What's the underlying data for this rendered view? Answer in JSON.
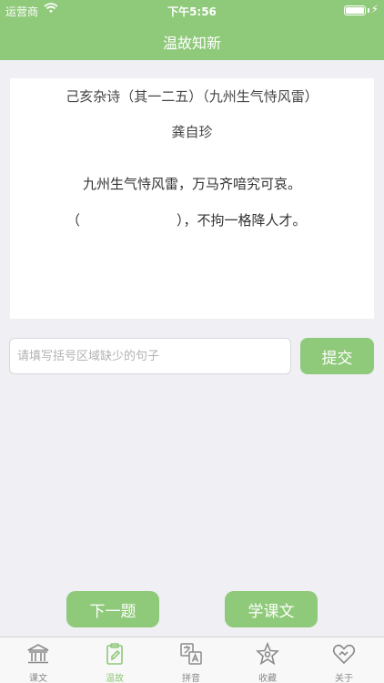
{
  "status_bar": {
    "carrier": "运营商",
    "time": "下午5:56"
  },
  "nav": {
    "title": "温故知新"
  },
  "poem": {
    "title": "己亥杂诗（其一二五）（九州生气恃风雷）",
    "author": "龚自珍",
    "line1": "九州生气恃风雷，万马齐喑究可哀。",
    "line2_open": "（",
    "line2_rest": "），不拘一格降人才。"
  },
  "answer": {
    "placeholder": "请填写括号区域缺少的句子",
    "submit_label": "提交"
  },
  "actions": {
    "next_label": "下一题",
    "learn_label": "学课文"
  },
  "tabs": [
    {
      "label": "课文",
      "icon": "temple-icon"
    },
    {
      "label": "温故",
      "icon": "notepad-icon"
    },
    {
      "label": "拼音",
      "icon": "translate-icon"
    },
    {
      "label": "收藏",
      "icon": "star-icon"
    },
    {
      "label": "关于",
      "icon": "heart-hands-icon"
    }
  ],
  "colors": {
    "accent": "#8fc97a",
    "background": "#efeff4",
    "inactive": "#8a8a8a"
  }
}
